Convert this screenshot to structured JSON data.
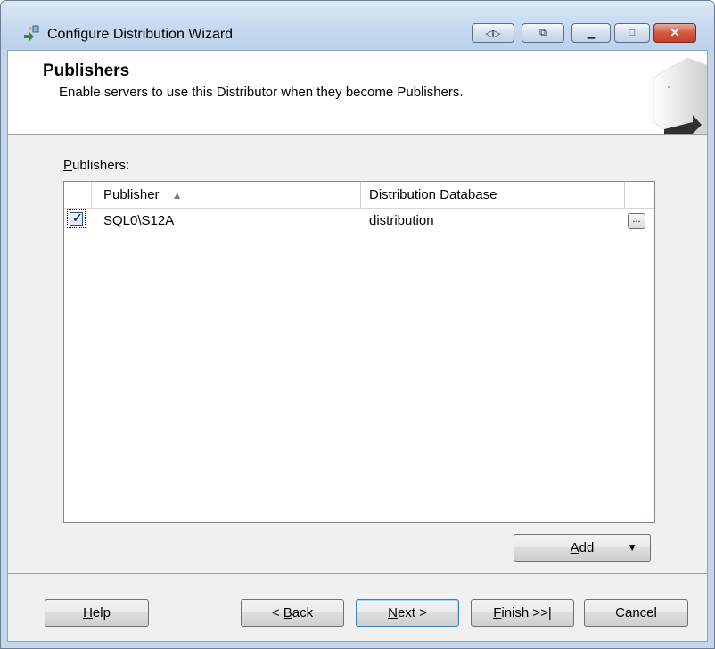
{
  "window": {
    "title": "Configure Distribution Wizard",
    "caption_buttons": [
      "◁▷",
      "⧉",
      "▁",
      "□",
      "✕"
    ]
  },
  "header": {
    "title": "Publishers",
    "subtitle": "Enable servers to use this Distributor when they become Publishers."
  },
  "publishers": {
    "label_underlined": "P",
    "label_rest": "ublishers:",
    "columns": [
      "Publisher",
      "Distribution Database"
    ],
    "sort_indicator": "▲",
    "rows": [
      {
        "checked": true,
        "check_glyph": "✓",
        "publisher": "SQL0\\S12A",
        "database": "distribution",
        "ellipsis": "..."
      }
    ]
  },
  "buttons": {
    "add_underlined": "A",
    "add_rest": "dd",
    "add_arrow": "▼",
    "help_underlined": "H",
    "help_rest": "elp",
    "back_prefix": "< ",
    "back_underlined": "B",
    "back_rest": "ack",
    "next_underlined": "N",
    "next_rest": "ext >",
    "finish_underlined": "F",
    "finish_rest": "inish >>|",
    "cancel": "Cancel"
  },
  "colors": {
    "title_bar": "#c5d8ef",
    "client_bg": "#f0f0f0",
    "close_button": "#c7402a"
  },
  "icons": [
    "wizard-icon",
    "server-arrow-art",
    "checkbox-checked-icon",
    "dropdown-arrow-icon"
  ]
}
